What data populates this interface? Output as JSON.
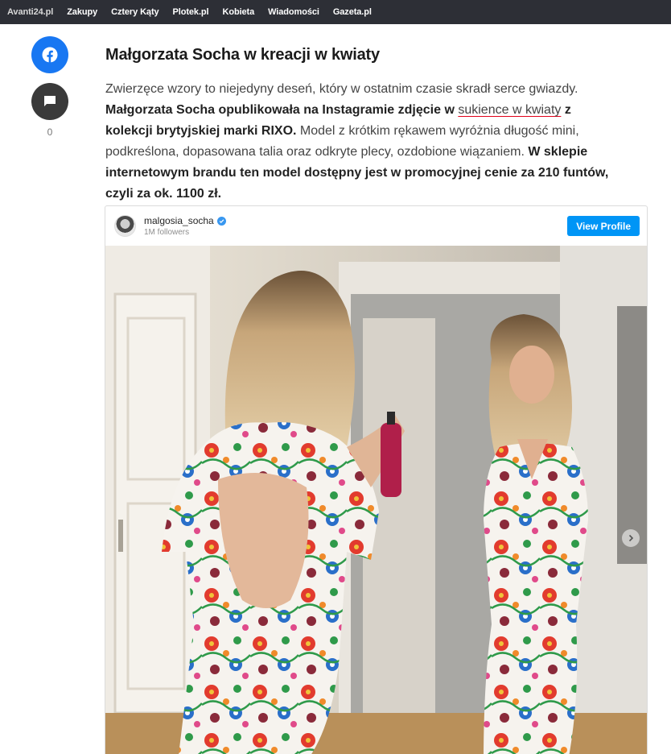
{
  "nav": {
    "items": [
      "Avanti24.pl",
      "Zakupy",
      "Cztery Kąty",
      "Plotek.pl",
      "Kobieta",
      "Wiadomości",
      "Gazeta.pl"
    ]
  },
  "share": {
    "facebook_icon": "facebook-icon",
    "comment_icon": "comment-icon",
    "comment_count": "0"
  },
  "article": {
    "title": "Małgorzata Socha w kreacji w kwiaty",
    "p1": "Zwierzęce wzory to niejedyny deseń, który w ostatnim czasie skradł serce gwiazdy. ",
    "p2_bold": "Małgorzata Socha opublikowała na Instagramie zdjęcie w ",
    "p3_link": "sukience w kwiaty",
    "p4_bold": " z kolekcji brytyjskiej marki RIXO.",
    "p5": " Model z krótkim rękawem wyróżnia długość mini, podkreślona, dopasowana talia oraz odkryte plecy, ozdobione wiązaniem. ",
    "p6_bold": "W sklepie internetowym brandu ten model dostępny jest w promocyjnej cenie za 210 funtów, czyli za ok. 1100 zł."
  },
  "embed": {
    "username": "malgosia_socha",
    "followers": "1M followers",
    "view_profile": "View Profile",
    "next_icon": "chevron-right-icon"
  },
  "colors": {
    "nav_bg": "#2d2f36",
    "facebook": "#1877f2",
    "instagram_button": "#0095f6",
    "link_underline": "#e2001a"
  }
}
